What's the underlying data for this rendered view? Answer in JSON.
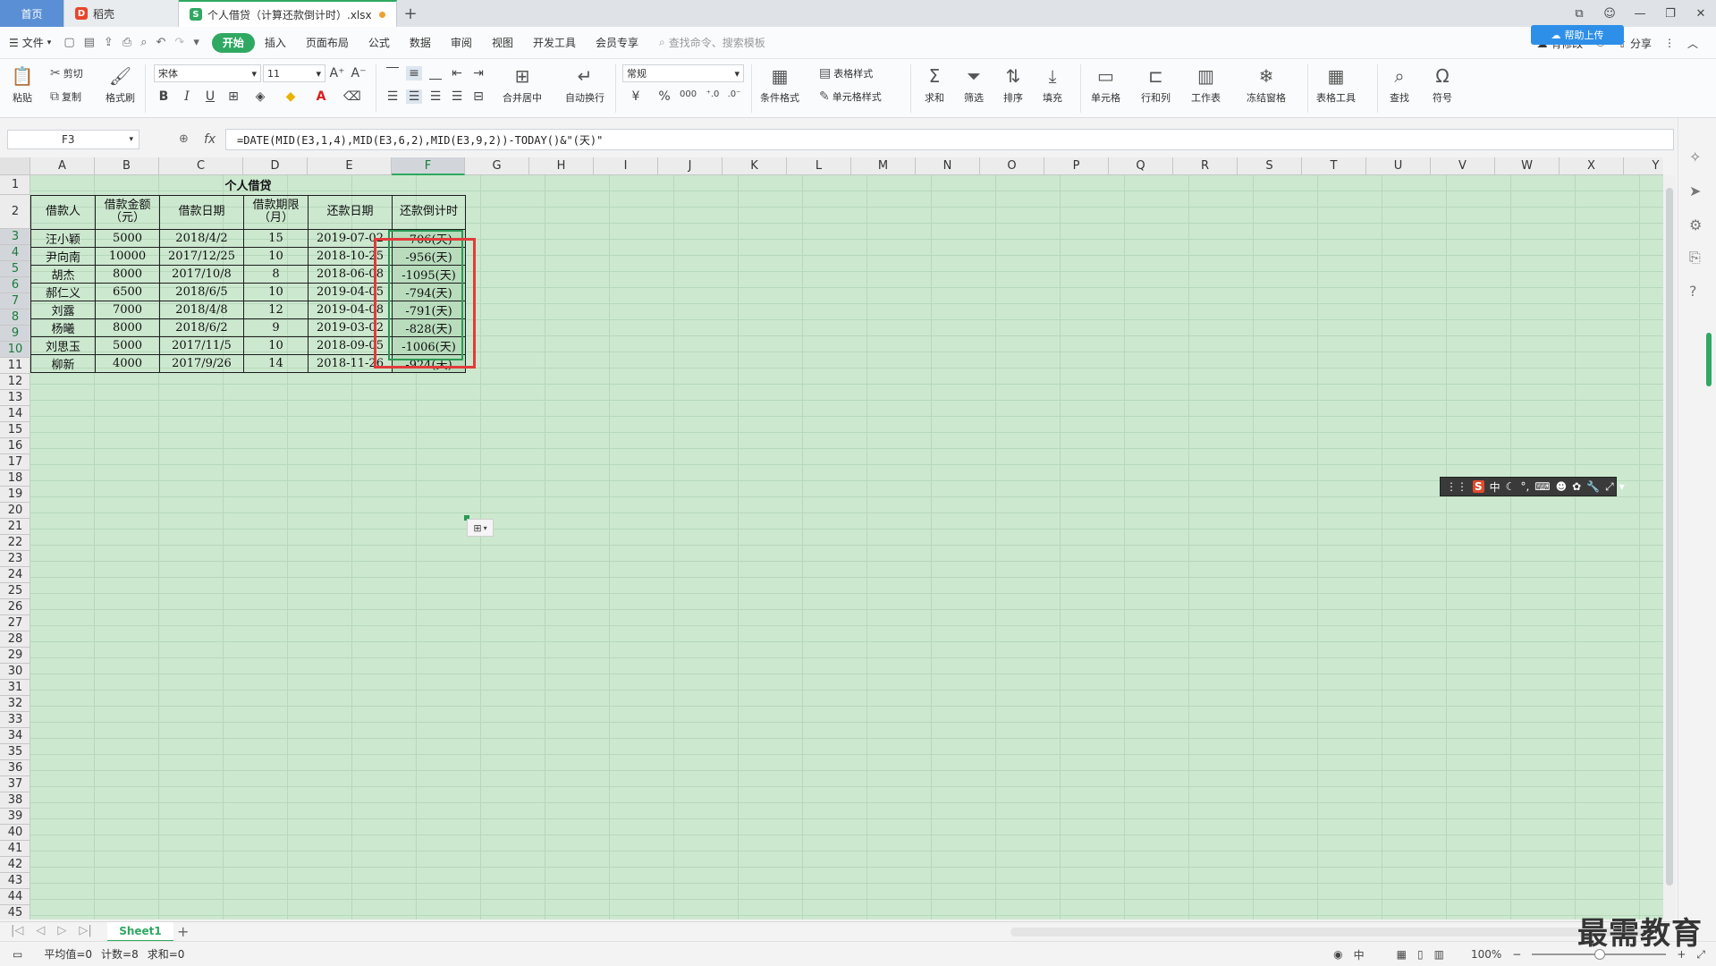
{
  "tabs": {
    "home": "首页",
    "docer": "稻壳",
    "document": "个人借贷（计算还款倒计时）.xlsx"
  },
  "menu": {
    "file": "文件",
    "items": [
      "开始",
      "插入",
      "页面布局",
      "公式",
      "数据",
      "审阅",
      "视图",
      "开发工具",
      "会员专享"
    ],
    "search_placeholder": "查找命令、搜索模板",
    "sync": "有修改",
    "share": "分享",
    "cloud_badge": "帮助上传"
  },
  "ribbon": {
    "paste": "粘贴",
    "cut": "剪切",
    "copy": "复制",
    "format_painter": "格式刷",
    "font_name": "宋体",
    "font_size": "11",
    "bold": "B",
    "italic": "I",
    "underline": "U",
    "merge_center": "合并居中",
    "wrap_text": "自动换行",
    "number_format": "常规",
    "currency": "¥",
    "percent": "%",
    "thousands": "000",
    "cond_format": "条件格式",
    "table_style": "表格样式",
    "cell_style": "单元格样式",
    "sum": "求和",
    "filter": "筛选",
    "sort": "排序",
    "fill": "填充",
    "cell": "单元格",
    "row_col": "行和列",
    "worksheet": "工作表",
    "freeze": "冻结窗格",
    "table_tools": "表格工具",
    "find": "查找",
    "symbol": "符号"
  },
  "formula_bar": {
    "name_box": "F3",
    "formula": "=DATE(MID(E3,1,4),MID(E3,6,2),MID(E3,9,2))-TODAY()&\"(天)\""
  },
  "columns": [
    "A",
    "B",
    "C",
    "D",
    "E",
    "F",
    "G",
    "H",
    "I",
    "J",
    "K",
    "L",
    "M",
    "N",
    "O",
    "P",
    "Q",
    "R",
    "S",
    "T",
    "U",
    "V",
    "W",
    "X",
    "Y"
  ],
  "rows": [
    "1",
    "2",
    "3",
    "4",
    "5",
    "6",
    "7",
    "8",
    "9",
    "10",
    "11",
    "12",
    "13",
    "14",
    "15",
    "16",
    "17",
    "18",
    "19",
    "20",
    "21",
    "22",
    "23",
    "24",
    "25",
    "26",
    "27",
    "28",
    "29",
    "30",
    "31",
    "32",
    "33",
    "34",
    "35",
    "36",
    "37",
    "38",
    "39",
    "40",
    "41",
    "42",
    "43",
    "44",
    "45"
  ],
  "sheet": {
    "title": "个人借贷",
    "headers": [
      "借款人",
      "借款金额（元）",
      "借款日期",
      "借款期限（月）",
      "还款日期",
      "还款倒计时"
    ],
    "rows": [
      [
        "汪小颖",
        "5000",
        "2018/4/2",
        "15",
        "2019-07-02",
        "-706(天)"
      ],
      [
        "尹向南",
        "10000",
        "2017/12/25",
        "10",
        "2018-10-25",
        "-956(天)"
      ],
      [
        "胡杰",
        "8000",
        "2017/10/8",
        "8",
        "2018-06-08",
        "-1095(天)"
      ],
      [
        "郝仁义",
        "6500",
        "2018/6/5",
        "10",
        "2019-04-05",
        "-794(天)"
      ],
      [
        "刘露",
        "7000",
        "2018/4/8",
        "12",
        "2019-04-08",
        "-791(天)"
      ],
      [
        "杨曦",
        "8000",
        "2018/6/2",
        "9",
        "2019-03-02",
        "-828(天)"
      ],
      [
        "刘思玉",
        "5000",
        "2017/11/5",
        "10",
        "2018-09-05",
        "-1006(天)"
      ],
      [
        "柳新",
        "4000",
        "2017/9/26",
        "14",
        "2018-11-26",
        "-924(天)"
      ]
    ]
  },
  "ime": {
    "logo": "S",
    "mode": "中"
  },
  "sheet_tab": "Sheet1",
  "status": {
    "average": "平均值=0",
    "count": "计数=8",
    "sum": "求和=0",
    "input_mode": "中",
    "zoom": "100%"
  },
  "watermark": "最需教育",
  "colors": {
    "accent": "#2fa862",
    "grid_bg": "#cce8cf",
    "highlight": "#e23b3b"
  }
}
